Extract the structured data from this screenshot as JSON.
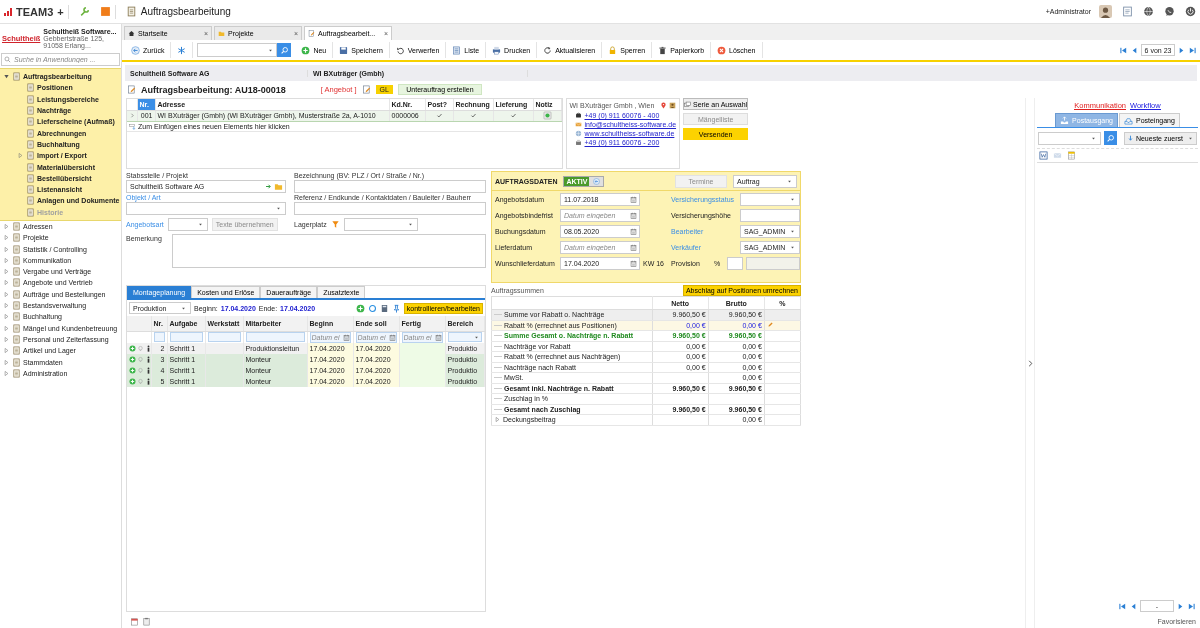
{
  "app_bar": {
    "brand": "TEAM3",
    "brand_plus": "+",
    "title": "Auftragsbearbeitung",
    "user": "+Administrator"
  },
  "sidebar": {
    "company_logo": "Schultheiß",
    "company_name": "Schultheiß Software...",
    "company_address": "Gebbertstraße 125, 91058 Erlang...",
    "search": {
      "placeholder": "Suche in Anwendungen ..."
    },
    "tree": [
      {
        "label": "Auftragsbearbeitung",
        "expanded": true,
        "children": [
          {
            "label": "Positionen",
            "disabled": false
          },
          {
            "label": "Leistungsbereiche",
            "disabled": false
          },
          {
            "label": "Nachträge",
            "disabled": false
          },
          {
            "label": "Lieferscheine (Aufmaß)",
            "disabled": false
          },
          {
            "label": "Abrechnungen",
            "disabled": false
          },
          {
            "label": "Buchhaltung",
            "disabled": false
          },
          {
            "label": "Import / Export",
            "disabled": false,
            "expanded": false
          },
          {
            "label": "Materialübersicht",
            "disabled": false
          },
          {
            "label": "Bestellübersicht",
            "disabled": false
          },
          {
            "label": "Listenansicht",
            "disabled": false
          },
          {
            "label": "Anlagen und Dokumente",
            "disabled": false
          },
          {
            "label": "Historie",
            "disabled": true
          }
        ]
      },
      {
        "label": "Adressen",
        "expanded": false
      },
      {
        "label": "Projekte",
        "expanded": false
      },
      {
        "label": "Statistik / Controlling",
        "expanded": false
      },
      {
        "label": "Kommunikation",
        "expanded": false
      },
      {
        "label": "Vergabe und Verträge",
        "expanded": false
      },
      {
        "label": "Angebote und Vertrieb",
        "expanded": false
      },
      {
        "label": "Aufträge und Bestellungen",
        "expanded": false
      },
      {
        "label": "Bestandsverwaltung",
        "expanded": false
      },
      {
        "label": "Buchhaltung",
        "expanded": false
      },
      {
        "label": "Mängel und Kundenbetreuung",
        "expanded": false
      },
      {
        "label": "Personal und Zeiterfassung",
        "expanded": false
      },
      {
        "label": "Artikel und Lager",
        "expanded": false
      },
      {
        "label": "Stammdaten",
        "expanded": false
      },
      {
        "label": "Administration",
        "expanded": false
      }
    ]
  },
  "tabs": [
    {
      "label": "Startseite",
      "close": "×",
      "selected": false
    },
    {
      "label": "Projekte",
      "close": "×",
      "selected": false
    },
    {
      "label": "Auftragsbearbeit...",
      "close": "×",
      "selected": true
    }
  ],
  "toolbar": {
    "back": "Zurück",
    "actions": [
      {
        "label": "Neu"
      },
      {
        "label": "Speichern"
      },
      {
        "label": "Verwerfen"
      },
      {
        "label": "Liste"
      },
      {
        "label": "Drucken"
      },
      {
        "label": "Aktualisieren"
      },
      {
        "label": "Sperren"
      },
      {
        "label": "Papierkorb"
      },
      {
        "label": "Löschen"
      }
    ],
    "pager": "6 von 23"
  },
  "header_bar": [
    "Schultheiß Software AG",
    "WI BXuträger  (Gmbh)"
  ],
  "order": {
    "title": "Auftragsbearbeitung: AU18-00018",
    "status": "[ Angebot ]",
    "gl_badge": "GL",
    "subcontract_button": "Unterauftrag erstellen"
  },
  "address_table": {
    "columns": [
      "Nr.",
      "Adresse",
      "Kd.Nr.",
      "Post?",
      "Rechnung",
      "Lieferung",
      "Notiz"
    ],
    "rows": [
      {
        "nr": "001",
        "adresse": "WI BXuträger (Gmbh) (WI BXuträger Gmbh), Musterstraße 2a, A-1010",
        "kd_nr": "0000006",
        "post": true,
        "rechnung": true,
        "lieferung": true,
        "notiz": true,
        "selected": true
      }
    ],
    "new_row_hint": "Zum Einfügen eines neuen Elements hier klicken"
  },
  "contact": {
    "title": "WI BXuträger  Gmbh ,  Wien",
    "lines": [
      {
        "kind": "phone",
        "text": "+49 (0) 911 60076 - 400"
      },
      {
        "kind": "mail",
        "text": "info@schultheiss-software.de"
      },
      {
        "kind": "web",
        "text": "www.schultheiss-software.de"
      },
      {
        "kind": "fax",
        "text": "+49 (0) 911 60076 - 200"
      }
    ]
  },
  "side_buttons": [
    {
      "label": "Serie an Auswahl",
      "kind": "default",
      "disabled": false
    },
    {
      "label": "Mängelliste",
      "kind": "default",
      "disabled": true
    },
    {
      "label": "Versenden",
      "kind": "primary",
      "disabled": false
    }
  ],
  "form": {
    "stabsstelle": {
      "label": "Stabsstelle / Projekt",
      "value": "Schultheiß Software AG"
    },
    "bezeichnung": {
      "label": "Bezeichnung (BV: PLZ / Ort / Straße / Nr.)"
    },
    "objekt": {
      "label": "Objekt / Art",
      "linked": true
    },
    "referenz": {
      "label": "Referenz / Endkunde / Kontaktdaten / Bauleiter / Bauherr"
    },
    "angebotsart": {
      "label": "Angebotsart",
      "linked": true,
      "button": "Texte übernehmen",
      "button_disabled": true
    },
    "lagerplatz": {
      "label": "Lagerplatz"
    },
    "bemerkung": {
      "label": "Bemerkung"
    }
  },
  "auftragsdaten": {
    "title": "AUFTRAGSDATEN",
    "toggle": {
      "label": "AKTIV",
      "on": true
    },
    "termine": {
      "label": "Termine",
      "disabled": true
    },
    "type": "Auftrag",
    "left": [
      {
        "label": "Angebotsdatum",
        "value": "11.07.2018"
      },
      {
        "label": "Angebotsbindefrist",
        "placeholder": "Datum eingeben"
      },
      {
        "label": "Buchungsdatum",
        "value": "08.05.2020"
      },
      {
        "label": "Lieferdatum",
        "placeholder": "Datum eingeben"
      },
      {
        "label": "Wunschlieferdatum",
        "value": "17.04.2020",
        "week": "KW 16"
      }
    ],
    "right": [
      {
        "label": "Versicherungsstatus",
        "linked": true,
        "kind": "select"
      },
      {
        "label": "Versicherungshöhe",
        "linked": false,
        "kind": "text"
      },
      {
        "label": "Bearbeiter",
        "linked": true,
        "kind": "select",
        "value": "SAG_ADMIN"
      },
      {
        "label": "Verkäufer",
        "linked": true,
        "kind": "select",
        "value": "SAG_ADMIN"
      },
      {
        "label": "Provision",
        "linked": false,
        "kind": "percent",
        "unit": "%"
      }
    ]
  },
  "bottom_tabs": [
    {
      "label": "Montageplanung",
      "selected": true
    },
    {
      "label": "Kosten und Erlöse",
      "selected": false
    },
    {
      "label": "Daueraufträge",
      "selected": false
    },
    {
      "label": "Zusatztexte",
      "selected": false
    }
  ],
  "planning": {
    "filter": "Produktion",
    "begin_label": "Beginn:",
    "begin": "17.04.2020",
    "end_label": "Ende:",
    "end": "17.04.2020",
    "check_button": "kontrollieren/bearbeiten",
    "columns": [
      "Nr.",
      "Aufgabe",
      "Werkstatt",
      "Mitarbeiter",
      "Beginn",
      "Ende soll",
      "Fertig",
      "Bereich"
    ],
    "date_placeholders": [
      "Datum ei",
      "Datum ei",
      "Datum ei"
    ],
    "rows": [
      {
        "nr": "2",
        "aufgabe": "Schritt 1",
        "werkstatt": "",
        "mitarbeiter": "Produktionsleitun",
        "beginn": "17.04.2020",
        "ende": "17.04.2020",
        "bereich": "Produktio",
        "selected": true
      },
      {
        "nr": "3",
        "aufgabe": "Schritt 1",
        "werkstatt": "",
        "mitarbeiter": "Monteur",
        "beginn": "17.04.2020",
        "ende": "17.04.2020",
        "bereich": "Produktio",
        "selected": false
      },
      {
        "nr": "4",
        "aufgabe": "Schritt 1",
        "werkstatt": "",
        "mitarbeiter": "Monteur",
        "beginn": "17.04.2020",
        "ende": "17.04.2020",
        "bereich": "Produktio",
        "selected": false
      },
      {
        "nr": "5",
        "aufgabe": "Schritt 1",
        "werkstatt": "",
        "mitarbeiter": "Monteur",
        "beginn": "17.04.2020",
        "ende": "17.04.2020",
        "bereich": "Produktio",
        "selected": false
      }
    ]
  },
  "summen": {
    "title": "Auftragssummen",
    "button": "Abschlag auf Positionen umrechnen",
    "columns": [
      "Netto",
      "Brutto",
      "%"
    ],
    "rows": [
      {
        "kind": "shaded",
        "label": "Summe vor Rabatt o. Nachträge",
        "netto": "9.960,50 €",
        "brutto": "9.960,50 €"
      },
      {
        "kind": "editable",
        "label": "Rabatt % (errechnet aus Positionen)",
        "netto": "0,00 €",
        "brutto": "0,00 €"
      },
      {
        "kind": "total",
        "label": "Summe Gesamt o. Nachträge n. Rabatt",
        "netto": "9.960,50 €",
        "brutto": "9.960,50 €"
      },
      {
        "kind": "plain",
        "label": "Nachträge vor Rabatt",
        "netto": "0,00 €",
        "brutto": "0,00 €"
      },
      {
        "kind": "plain",
        "label": "Rabatt % (errechnet aus Nachträgen)",
        "netto": "0,00 €",
        "brutto": "0,00 €"
      },
      {
        "kind": "plain",
        "label": "Nachträge nach Rabatt",
        "netto": "0,00 €",
        "brutto": "0,00 €"
      },
      {
        "kind": "plain",
        "label": "MwSt.",
        "brutto": "0,00 €"
      },
      {
        "kind": "bold",
        "label": "Gesamt inkl. Nachträge n. Rabatt",
        "netto": "9.960,50 €",
        "brutto": "9.960,50 €"
      },
      {
        "kind": "plain",
        "label": "Zuschlag in %"
      },
      {
        "kind": "bold",
        "label": "Gesamt nach Zuschlag",
        "netto": "9.960,50 €",
        "brutto": "9.960,50 €"
      },
      {
        "kind": "expandable",
        "label": "Deckungsbeitrag",
        "brutto": "0,00 €"
      }
    ]
  },
  "right_panel": {
    "links": [
      {
        "label": "Kommunikation",
        "color": "#e02020"
      },
      {
        "label": "Workflow",
        "color": "#2020e0"
      }
    ],
    "tabs": [
      {
        "label": "Postausgang",
        "selected": true
      },
      {
        "label": "Posteingang",
        "selected": false
      }
    ],
    "sort": "Neueste zuerst",
    "pager": "-"
  },
  "footer": {
    "favorite": "Favorisieren"
  }
}
